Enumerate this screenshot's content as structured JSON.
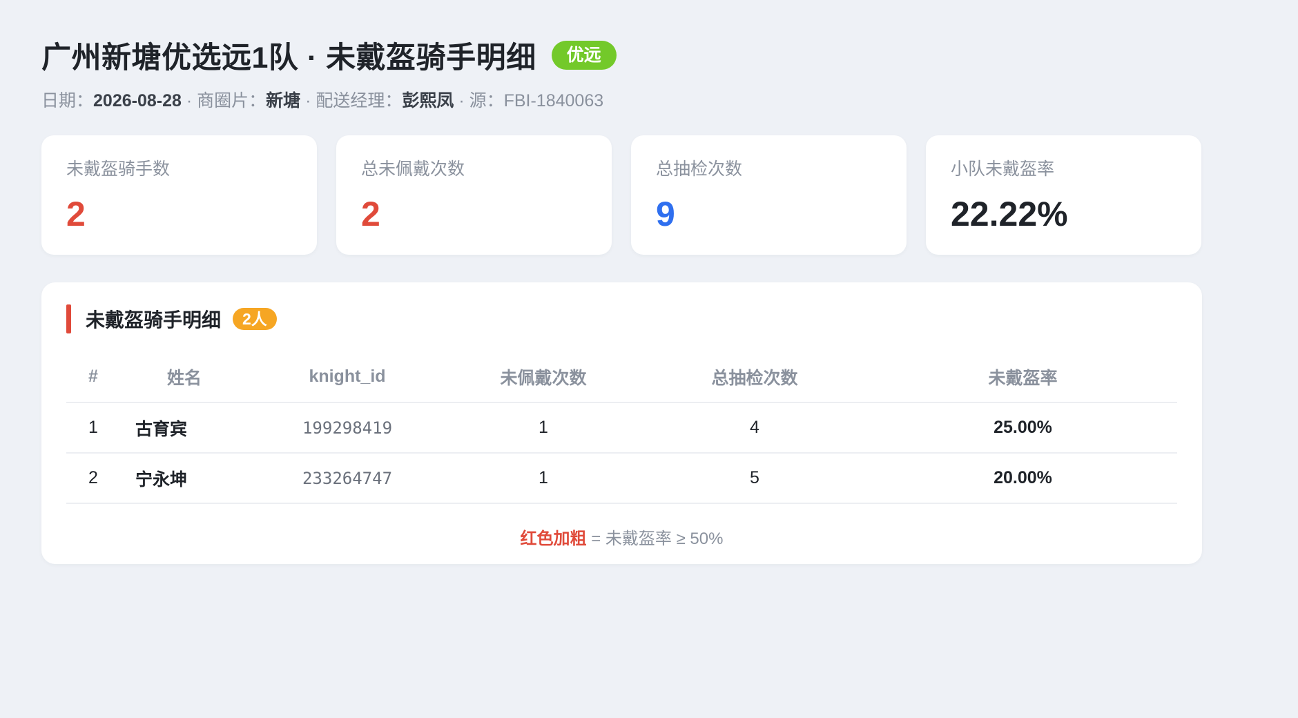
{
  "header": {
    "title": "广州新塘优选远1队 · 未戴盔骑手明细",
    "tag": "优远",
    "date_label": "日期：",
    "date": "2026-08-28",
    "area_label": " · 商圈片：",
    "area": "新塘",
    "manager_label": " · 配送经理：",
    "manager": "彭熙凤",
    "source_label": " · 源：FBI-1840063"
  },
  "stats": [
    {
      "label": "未戴盔骑手数",
      "value": "2",
      "color": "#e04a3a"
    },
    {
      "label": "总未佩戴次数",
      "value": "2",
      "color": "#e04a3a"
    },
    {
      "label": "总抽检次数",
      "value": "9",
      "color": "#2f6fef"
    },
    {
      "label": "小队未戴盔率",
      "value": "22.22%",
      "color": "#1f2329"
    }
  ],
  "panel": {
    "title": "未戴盔骑手明细",
    "badge": "2人",
    "columns": [
      "#",
      "姓名",
      "knight_id",
      "未佩戴次数",
      "总抽检次数",
      "未戴盔率"
    ],
    "rows": [
      {
        "idx": "1",
        "name": "古育宾",
        "knight_id": "199298419",
        "missed": "1",
        "checks": "4",
        "rate": "25.00%"
      },
      {
        "idx": "2",
        "name": "宁永坤",
        "knight_id": "233264747",
        "missed": "1",
        "checks": "5",
        "rate": "20.00%"
      }
    ],
    "legend_highlight": "红色加粗",
    "legend_text": " = 未戴盔率 ≥ 50%"
  }
}
